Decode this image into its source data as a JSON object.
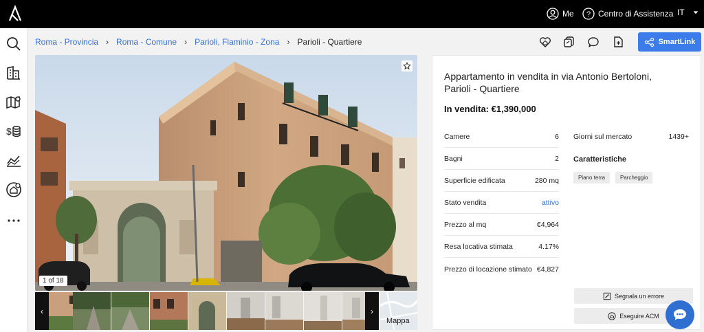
{
  "header": {
    "me_label": "Me",
    "help_label": "Centro di Assistenza",
    "lang_label": "IT"
  },
  "breadcrumb": {
    "items": [
      "Roma - Provincia",
      "Roma - Comune",
      "Parioli, Flaminio - Zona"
    ],
    "current": "Parioli - Quartiere",
    "separator": "›"
  },
  "toolbar": {
    "smartlink_label": "SmartLink"
  },
  "gallery": {
    "counter": "1 of 18",
    "map_label": "Mappa",
    "prev": "‹",
    "next": "›"
  },
  "listing": {
    "title": "Appartamento in vendita in via Antonio Bertoloni, Parioli - Quartiere",
    "price": "In vendita: €1,390,000",
    "rows": [
      {
        "label": "Camere",
        "value": "6"
      },
      {
        "label": "Bagni",
        "value": "2"
      },
      {
        "label": "Superficie edificata",
        "value": "280 mq"
      },
      {
        "label": "Stato vendita",
        "value": "attivo"
      },
      {
        "label": "Prezzo al mq",
        "value": "€4,964"
      },
      {
        "label": "Resa locativa stimata",
        "value": "4.17%"
      },
      {
        "label": "Prezzo di locazione stimato",
        "value": "€4,827"
      }
    ],
    "days_label": "Giorni sul mercato",
    "days_value": "1439+",
    "features_title": "Caratteristiche",
    "features": [
      "Piano terra",
      "Parcheggio"
    ],
    "report_label": "Segnala un errore",
    "acm_label": "Eseguire ACM"
  },
  "colors": {
    "accent": "#3b7bea",
    "link": "#2f6fd1",
    "topbar": "#000000"
  }
}
